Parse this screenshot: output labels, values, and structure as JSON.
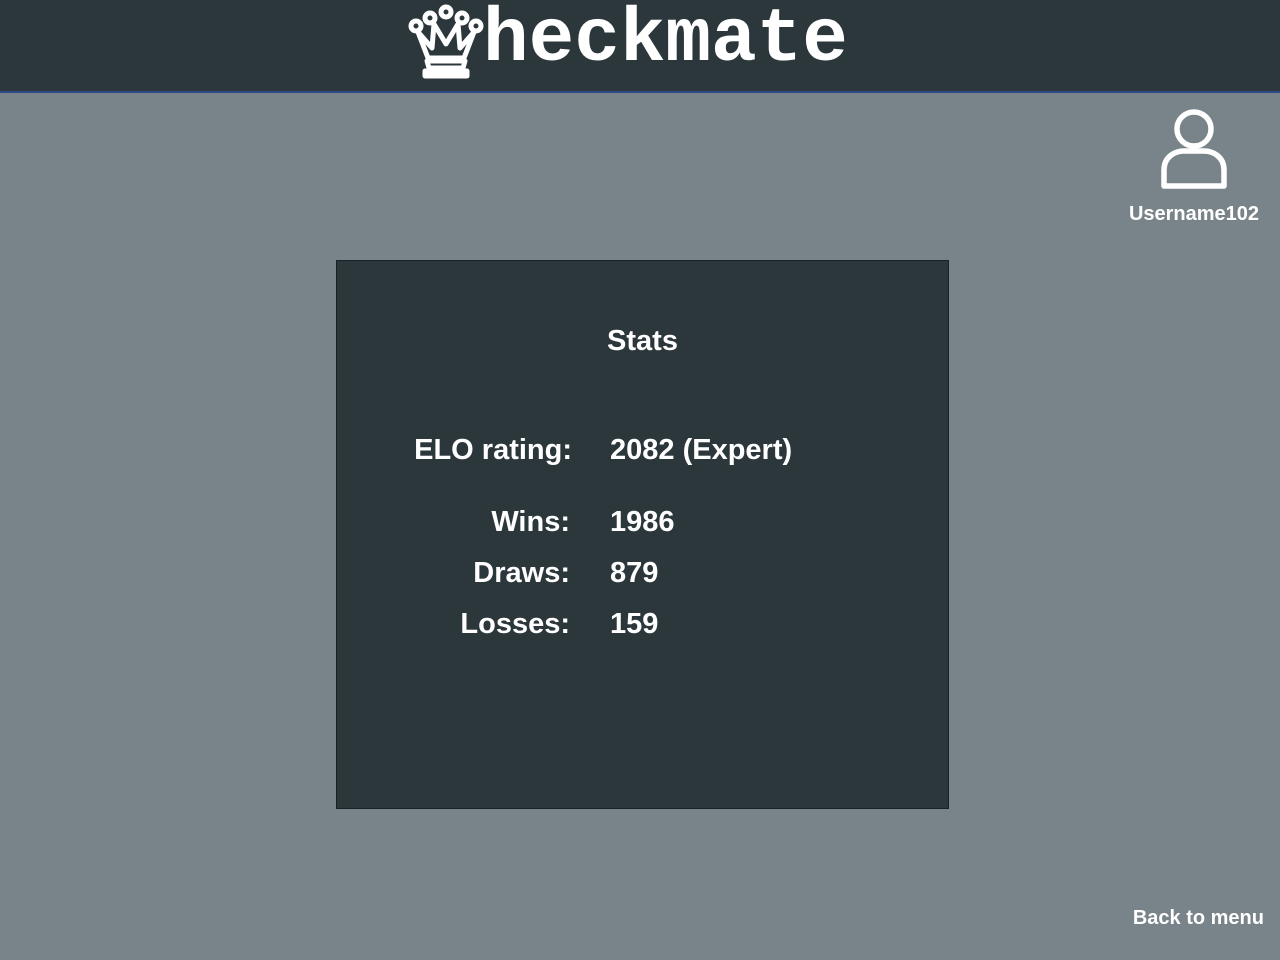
{
  "header": {
    "logo_text": "heckmate",
    "logo_icon": "queen-chess-piece-icon"
  },
  "profile": {
    "icon": "user-icon",
    "username": "Username102"
  },
  "stats": {
    "title": "Stats",
    "rows": [
      {
        "label": "ELO rating:",
        "value": "2082 (Expert)"
      },
      {
        "label": "Wins:",
        "value": "1986"
      },
      {
        "label": "Draws:",
        "value": "879"
      },
      {
        "label": "Losses:",
        "value": "159"
      }
    ]
  },
  "nav": {
    "back_label": "Back to menu"
  },
  "colors": {
    "page_background": "#788489",
    "panel_background": "#2c373c",
    "header_accent_line": "#2e4a8a",
    "text": "#ffffff"
  }
}
